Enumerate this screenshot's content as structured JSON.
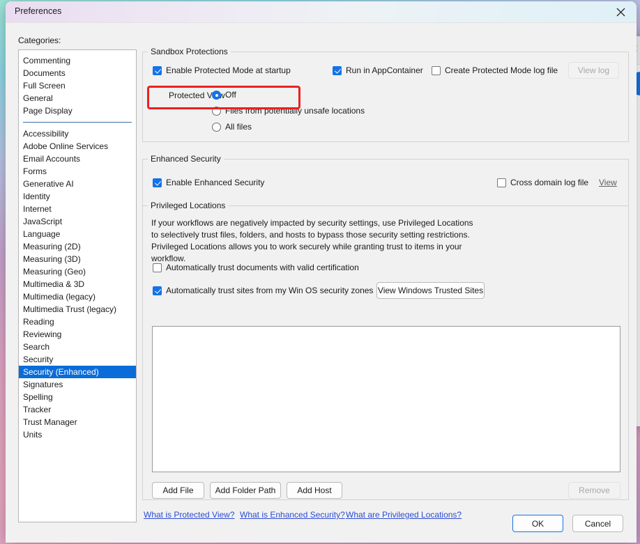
{
  "window": {
    "title": "Preferences",
    "close_icon": "close-icon"
  },
  "sidebar": {
    "label": "Categories:",
    "groups": [
      [
        "Commenting",
        "Documents",
        "Full Screen",
        "General",
        "Page Display"
      ],
      [
        "Accessibility",
        "Adobe Online Services",
        "Email Accounts",
        "Forms",
        "Generative AI",
        "Identity",
        "Internet",
        "JavaScript",
        "Language",
        "Measuring (2D)",
        "Measuring (3D)",
        "Measuring (Geo)",
        "Multimedia & 3D",
        "Multimedia (legacy)",
        "Multimedia Trust (legacy)",
        "Reading",
        "Reviewing",
        "Search",
        "Security",
        "Security (Enhanced)",
        "Signatures",
        "Spelling",
        "Tracker",
        "Trust Manager",
        "Units"
      ]
    ],
    "selected": "Security (Enhanced)"
  },
  "sandbox": {
    "title": "Sandbox Protections",
    "enable_protected_mode": {
      "label": "Enable Protected Mode at startup",
      "checked": true
    },
    "run_in_appcontainer": {
      "label": "Run in AppContainer",
      "checked": true
    },
    "create_log_file": {
      "label": "Create Protected Mode log file",
      "checked": false
    },
    "view_log_button": {
      "label": "View log",
      "disabled": true
    },
    "protected_view_label": "Protected View",
    "protected_view_options": [
      {
        "label": "Off",
        "selected": true
      },
      {
        "label": "Files from potentially unsafe locations",
        "selected": false
      },
      {
        "label": "All files",
        "selected": false
      }
    ]
  },
  "enhanced_security": {
    "title": "Enhanced Security",
    "enable": {
      "label": "Enable Enhanced Security",
      "checked": true
    },
    "cross_domain_log": {
      "label": "Cross domain log file",
      "checked": false
    },
    "view_link": "View"
  },
  "privileged_locations": {
    "title": "Privileged Locations",
    "description": "If your workflows are negatively impacted by security settings, use Privileged Locations to selectively trust files, folders, and hosts to bypass those security setting restrictions. Privileged Locations allows you to work securely while granting trust to items in your workflow.",
    "auto_trust_documents": {
      "label": "Automatically trust documents with valid certification",
      "checked": false
    },
    "auto_trust_sites": {
      "label": "Automatically trust sites from my Win OS security zones",
      "checked": true
    },
    "view_trusted_sites_button": "View Windows Trusted Sites",
    "list_items": [],
    "add_file_button": "Add File",
    "add_folder_button": "Add Folder Path",
    "add_host_button": "Add Host",
    "remove_button": {
      "label": "Remove",
      "disabled": true
    }
  },
  "help_links": [
    "What is Protected View?",
    "What is Enhanced Security?",
    "What are Privileged Locations?"
  ],
  "footer": {
    "ok_button": "OK",
    "cancel_button": "Cancel"
  },
  "colors": {
    "accent": "#1473e6",
    "selection": "#0a6cd8",
    "highlight": "#ec2020",
    "link": "#2c4cd4"
  }
}
